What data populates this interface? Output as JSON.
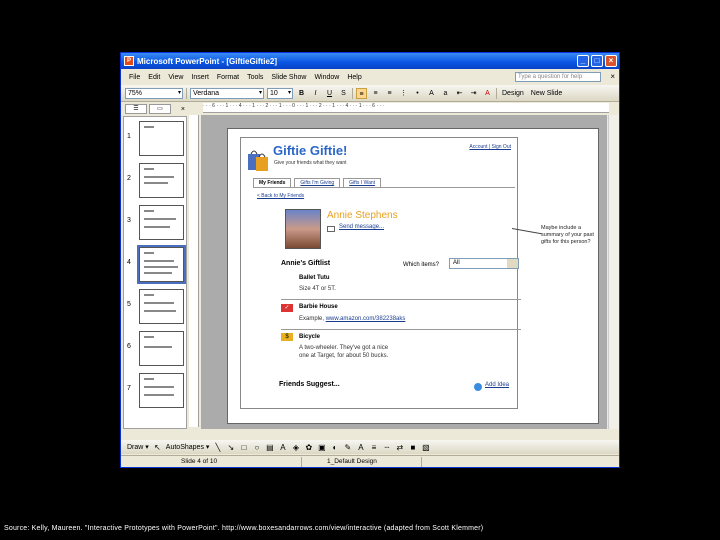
{
  "window": {
    "title": "Microsoft PowerPoint - [GiftieGiftie2]",
    "buttons": {
      "minimize": "_",
      "maximize": "□",
      "close": "×"
    }
  },
  "menubar": {
    "items": [
      "File",
      "Edit",
      "View",
      "Insert",
      "Format",
      "Tools",
      "Slide Show",
      "Window",
      "Help"
    ],
    "ask_placeholder": "Type a question for help",
    "close": "×"
  },
  "toolbar": {
    "zoom": "75%",
    "font": "Verdana",
    "size": "10",
    "bold": "B",
    "italic": "I",
    "underline": "U",
    "design_label": "Design",
    "new_slide_label": "New Slide"
  },
  "slide_pane": {
    "tab_outline": "☰",
    "tab_slides": "▭",
    "close": "×",
    "thumbnails": [
      "1",
      "2",
      "3",
      "4",
      "5",
      "6",
      "7"
    ],
    "selected": 4
  },
  "ruler": {
    "marks": "· · · 6 · · · 1 · · · 4 · · · 1 · · · 2 · · · 1 · · · 0 · · · 1 · · · 2 · · · 1 · · · 4 · · · 1 · · · 6 · · ·"
  },
  "slide": {
    "app_title": "Giftie Giftie!",
    "tagline": "Give your friends what they want",
    "account_links": "Account | Sign Out",
    "tabs": [
      "My Friends",
      "Gifts I'm Giving",
      "Gifts I Want"
    ],
    "back_link": "< Back to My Friends",
    "friend_name": "Annie Stephens",
    "send_message": "Send message...",
    "giftlist_heading": "Annie's Giftlist",
    "which_items_label": "Which items?",
    "which_items_value": "All",
    "items": [
      {
        "name": "Ballet Tutu",
        "desc": "Size 4T or 5T."
      },
      {
        "name": "Barbie House",
        "desc_prefix": "Example, ",
        "desc_link": "www.amazon.com/382238aks"
      },
      {
        "name": "Bicycle",
        "desc_line1": "A two-wheeler. They've got a nice",
        "desc_line2": "one at Target, for about 50 bucks."
      }
    ],
    "friends_suggest": "Friends Suggest...",
    "add_idea": "Add Idea",
    "annotation": "Maybe include a summary of your past gifts for this person?"
  },
  "drawbar": {
    "draw_label": "Draw ▾",
    "autoshapes_label": "AutoShapes ▾"
  },
  "statusbar": {
    "slide_info": "Slide 4 of 10",
    "design": "1_Default Design"
  },
  "caption": "Source: Kelly, Maureen. \"Interactive Prototypes with PowerPoint\". http://www.boxesandarrows.com/view/interactive (adapted from Scott Klemmer)"
}
